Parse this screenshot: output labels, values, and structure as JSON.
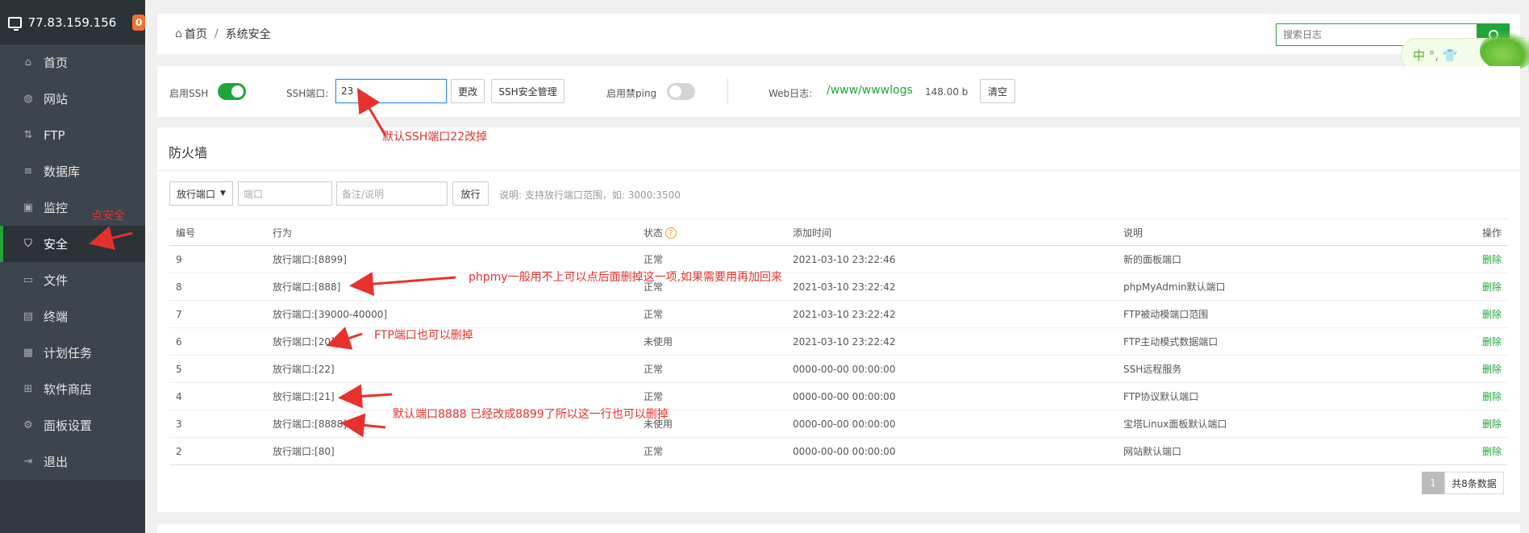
{
  "sidebar": {
    "ip": "77.83.159.156",
    "badge": "0",
    "items": [
      {
        "label": "首页",
        "icon": "home-icon",
        "glyph": "⌂"
      },
      {
        "label": "网站",
        "icon": "globe-icon",
        "glyph": "◍"
      },
      {
        "label": "FTP",
        "icon": "ftp-icon",
        "glyph": "⇅"
      },
      {
        "label": "数据库",
        "icon": "database-icon",
        "glyph": "≡"
      },
      {
        "label": "监控",
        "icon": "monitor-icon",
        "glyph": "▣"
      },
      {
        "label": "安全",
        "icon": "shield-icon",
        "glyph": "⛉"
      },
      {
        "label": "文件",
        "icon": "folder-icon",
        "glyph": "▭"
      },
      {
        "label": "终端",
        "icon": "terminal-icon",
        "glyph": "▤"
      },
      {
        "label": "计划任务",
        "icon": "calendar-icon",
        "glyph": "▦"
      },
      {
        "label": "软件商店",
        "icon": "apps-icon",
        "glyph": "⊞"
      },
      {
        "label": "面板设置",
        "icon": "gear-icon",
        "glyph": "⚙"
      },
      {
        "label": "退出",
        "icon": "logout-icon",
        "glyph": "⇥"
      }
    ],
    "active_index": 5
  },
  "breadcrumb": {
    "home": "首页",
    "separator": "/",
    "current": "系统安全"
  },
  "search": {
    "placeholder": "搜索日志"
  },
  "ime": {
    "text": "中 °, 👕"
  },
  "ssh": {
    "enable_ssh_label": "启用SSH",
    "enable_ssh": true,
    "port_label": "SSH端口:",
    "port_value": "23",
    "change_button": "更改",
    "manage_button": "SSH安全管理",
    "ping_label": "启用禁ping",
    "ping_enabled": false,
    "weblog_label": "Web日志:",
    "weblog_path": "/www/wwwlogs",
    "weblog_size": "148.00 b",
    "clear_button": "清空"
  },
  "firewall": {
    "title": "防火墙",
    "mode_select": "放行端口",
    "port_placeholder": "端口",
    "note_placeholder": "备注/说明",
    "allow_button": "放行",
    "hint": "说明: 支持放行端口范围，如: 3000:3500",
    "columns": [
      "编号",
      "行为",
      "状态",
      "添加时间",
      "说明",
      "操作"
    ],
    "rows": [
      {
        "id": "9",
        "action": "放行端口:[8899]",
        "status": "正常",
        "time": "2021-03-10 23:22:46",
        "desc": "新的面板端口",
        "op": "删除"
      },
      {
        "id": "8",
        "action": "放行端口:[888]",
        "status": "正常",
        "time": "2021-03-10 23:22:42",
        "desc": "phpMyAdmin默认端口",
        "op": "删除"
      },
      {
        "id": "7",
        "action": "放行端口:[39000-40000]",
        "status": "正常",
        "time": "2021-03-10 23:22:42",
        "desc": "FTP被动模端口范围",
        "op": "删除"
      },
      {
        "id": "6",
        "action": "放行端口:[20]",
        "status": "未使用",
        "time": "2021-03-10 23:22:42",
        "desc": "FTP主动模式数据端口",
        "op": "删除"
      },
      {
        "id": "5",
        "action": "放行端口:[22]",
        "status": "正常",
        "time": "0000-00-00 00:00:00",
        "desc": "SSH远程服务",
        "op": "删除"
      },
      {
        "id": "4",
        "action": "放行端口:[21]",
        "status": "正常",
        "time": "0000-00-00 00:00:00",
        "desc": "FTP协议默认端口",
        "op": "删除"
      },
      {
        "id": "3",
        "action": "放行端口:[8888]",
        "status": "未使用",
        "time": "0000-00-00 00:00:00",
        "desc": "宝塔Linux面板默认端口",
        "op": "删除"
      },
      {
        "id": "2",
        "action": "放行端口:[80]",
        "status": "正常",
        "time": "0000-00-00 00:00:00",
        "desc": "网站默认端口",
        "op": "删除"
      }
    ],
    "page": "1",
    "total": "共8条数据"
  },
  "annotations": {
    "ssh_port": "默认SSH端口22改掉",
    "click_security": "点安全",
    "phpmy": "phpmy一般用不上可以点后面删掉这一项,如果需要用再加回来",
    "ftp": "FTP端口也可以删掉",
    "default_port": "默认端口8888 已经改成8899了所以这一行也可以删掉"
  },
  "colors": {
    "accent": "#20a53a",
    "sidebar": "#3c444d",
    "annotation": "#e8312c",
    "badge": "#f0732d"
  }
}
